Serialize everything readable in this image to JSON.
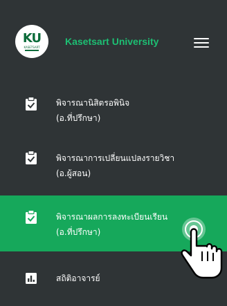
{
  "header": {
    "logo_text": "KU",
    "logo_subtext": "KASETSART",
    "brand": "Kasetsart University",
    "menu_icon": "hamburger-menu-icon"
  },
  "colors": {
    "background": "#2f3436",
    "accent": "#16a85b",
    "brand_text": "#1dbf73"
  },
  "menu": {
    "items": [
      {
        "icon": "clipboard-check-icon",
        "line1": "พิจารณานิสิตรอพินิจ",
        "line2": "(อ.ที่ปรึกษา)",
        "active": false
      },
      {
        "icon": "clipboard-check-icon",
        "line1": "พิจารณาการเปลี่ยนแปลงรายวิชา",
        "line2": "(อ.ผู้สอน)",
        "active": false
      },
      {
        "icon": "clipboard-check-icon",
        "line1": "พิจารณาผลการลงทะเบียนเรียน",
        "line2": "(อ.ที่ปรึกษา)",
        "active": true
      },
      {
        "icon": "bar-chart-icon",
        "line1": "สถิติอาจารย์",
        "line2": "",
        "active": false
      }
    ]
  }
}
